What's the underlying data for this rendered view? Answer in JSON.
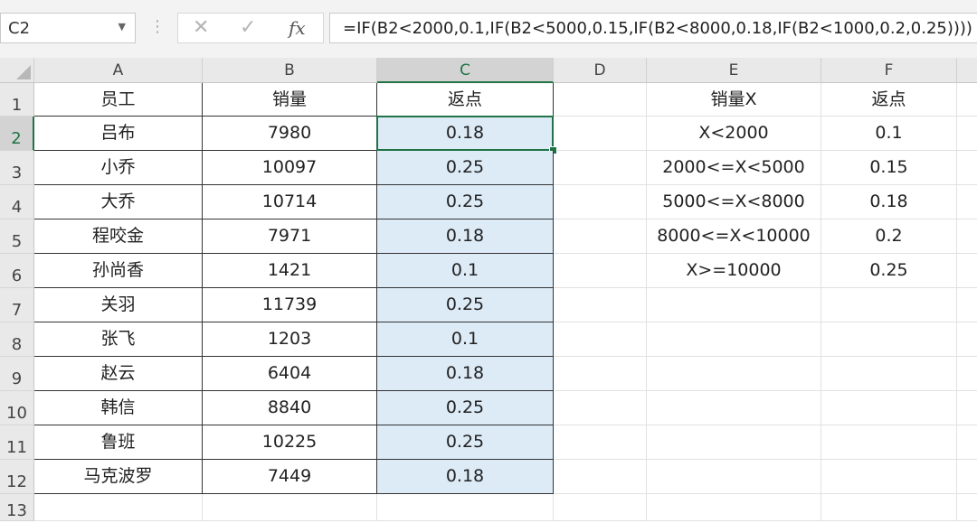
{
  "name_box": {
    "value": "C2"
  },
  "formula_bar": {
    "cancel_glyph": "✕",
    "enter_glyph": "✓",
    "fx_label": "fx",
    "formula": "=IF(B2<2000,0.1,IF(B2<5000,0.15,IF(B2<8000,0.18,IF(B2<1000,0.2,0.25))))"
  },
  "columns": [
    "A",
    "B",
    "C",
    "D",
    "E",
    "F"
  ],
  "rows": [
    "1",
    "2",
    "3",
    "4",
    "5",
    "6",
    "7",
    "8",
    "9",
    "10",
    "11",
    "12",
    "13"
  ],
  "active_cell": "C2",
  "sheet": {
    "A": [
      "员工",
      "吕布",
      "小乔",
      "大乔",
      "程咬金",
      "孙尚香",
      "关羽",
      "张飞",
      "赵云",
      "韩信",
      "鲁班",
      "马克波罗",
      ""
    ],
    "B": [
      "销量",
      "7980",
      "10097",
      "10714",
      "7971",
      "1421",
      "11739",
      "1203",
      "6404",
      "8840",
      "10225",
      "7449",
      ""
    ],
    "C": [
      "返点",
      "0.18",
      "0.25",
      "0.25",
      "0.18",
      "0.1",
      "0.25",
      "0.1",
      "0.18",
      "0.25",
      "0.25",
      "0.18",
      ""
    ],
    "D": [
      "",
      "",
      "",
      "",
      "",
      "",
      "",
      "",
      "",
      "",
      "",
      "",
      ""
    ],
    "E": [
      "销量X",
      "X<2000",
      "2000<=X<5000",
      "5000<=X<8000",
      "8000<=X<10000",
      "X>=10000",
      "",
      "",
      "",
      "",
      "",
      "",
      ""
    ],
    "F": [
      "返点",
      "0.1",
      "0.15",
      "0.18",
      "0.2",
      "0.25",
      "",
      "",
      "",
      "",
      "",
      "",
      ""
    ]
  },
  "colors": {
    "accent_green": "#217346",
    "selection_fill": "#ddebf7",
    "header_bg": "#e9e9e9"
  }
}
